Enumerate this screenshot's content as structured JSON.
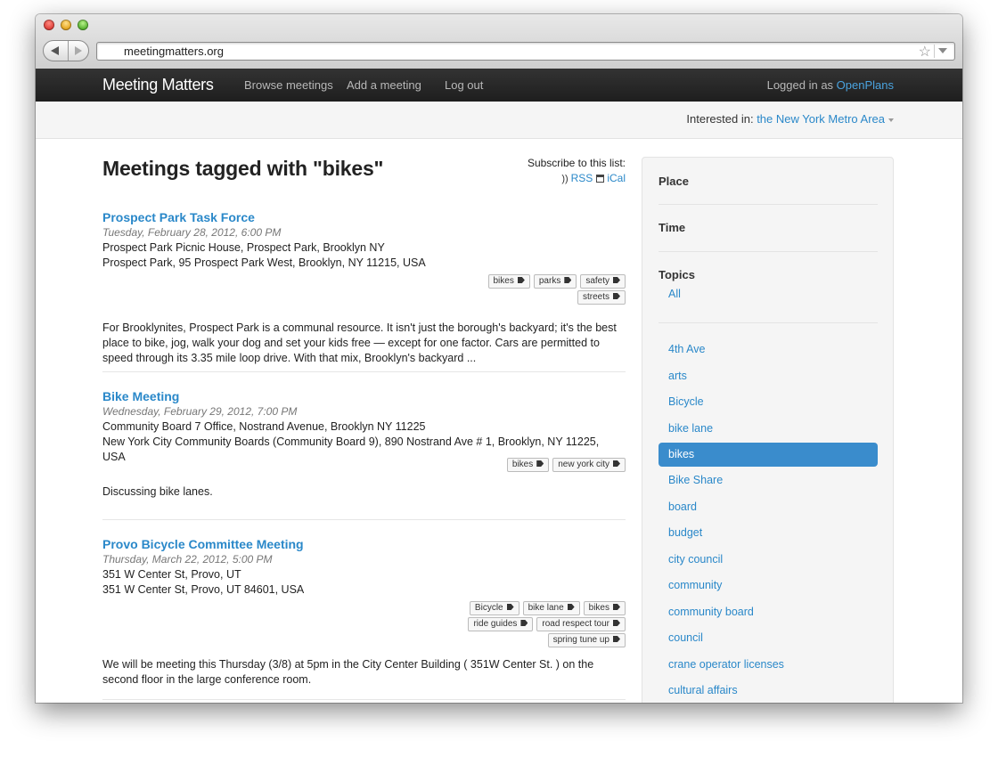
{
  "browser": {
    "url": "meetingmatters.org"
  },
  "navbar": {
    "brand": "Meeting Matters",
    "links": [
      "Browse meetings",
      "Add a meeting",
      "Log out"
    ],
    "logged_in_prefix": "Logged in as",
    "username": "OpenPlans"
  },
  "interest": {
    "label": "Interested in:",
    "location": "the New York Metro Area"
  },
  "page": {
    "title": "Meetings tagged with \"bikes\"",
    "subscribe_label": "Subscribe to this list:",
    "rss": "RSS",
    "ical": "iCal"
  },
  "meetings": [
    {
      "title": "Prospect Park Task Force",
      "date": "Tuesday, February 28, 2012, 6:00 PM",
      "venue": "Prospect Park Picnic House, Prospect Park, Brooklyn NY",
      "address": "Prospect Park, 95 Prospect Park West, Brooklyn, NY 11215, USA",
      "tag_rows": [
        [
          "bikes",
          "parks",
          "safety"
        ],
        [
          "streets"
        ]
      ],
      "description": [
        "For Brooklynites, Prospect Park is a communal resource. It isn't just the borough's backyard; it's the best",
        "place to bike, jog, walk your dog and set your kids free — except for one factor. Cars are permitted to",
        "speed through its 3.35 mile loop drive. With that mix, Brooklyn's backyard ..."
      ]
    },
    {
      "title": "Bike Meeting",
      "date": "Wednesday, February 29, 2012, 7:00 PM",
      "venue": "Community Board 7 Office, Nostrand Avenue, Brooklyn NY 11225",
      "address": [
        "New York City Community Boards (Community Board 9), 890 Nostrand Ave # 1, Brooklyn, NY 11225,",
        "USA"
      ],
      "tag_rows": [
        [
          "bikes",
          "new york city"
        ]
      ],
      "description": [
        "Discussing bike lanes."
      ]
    },
    {
      "title": "Provo Bicycle Committee Meeting",
      "date": "Thursday, March 22, 2012, 5:00 PM",
      "venue": "351 W Center St, Provo, UT",
      "address": "351 W Center St, Provo, UT 84601, USA",
      "tag_rows": [
        [
          "Bicycle",
          "bike lane",
          "bikes"
        ],
        [
          "ride guides",
          "road respect tour"
        ],
        [
          "spring tune up"
        ]
      ],
      "description": [
        "We will be meeting this Thursday (3/8) at 5pm in the City Center Building ( 351W Center St. ) on the",
        "second floor in the large conference room."
      ]
    }
  ],
  "sidebar": {
    "place": "Place",
    "time": "Time",
    "topics_heading": "Topics",
    "all": "All",
    "topics": [
      "4th Ave",
      "arts",
      "Bicycle",
      "bike lane",
      "bikes",
      "Bike Share",
      "board",
      "budget",
      "city council",
      "community",
      "community board",
      "council",
      "crane operator licenses",
      "cultural affairs"
    ],
    "active_topic": "bikes"
  },
  "colors": {
    "link": "#2a88c9",
    "active_topic_bg": "#3a8ccc",
    "navbar_bg": "#222222"
  }
}
